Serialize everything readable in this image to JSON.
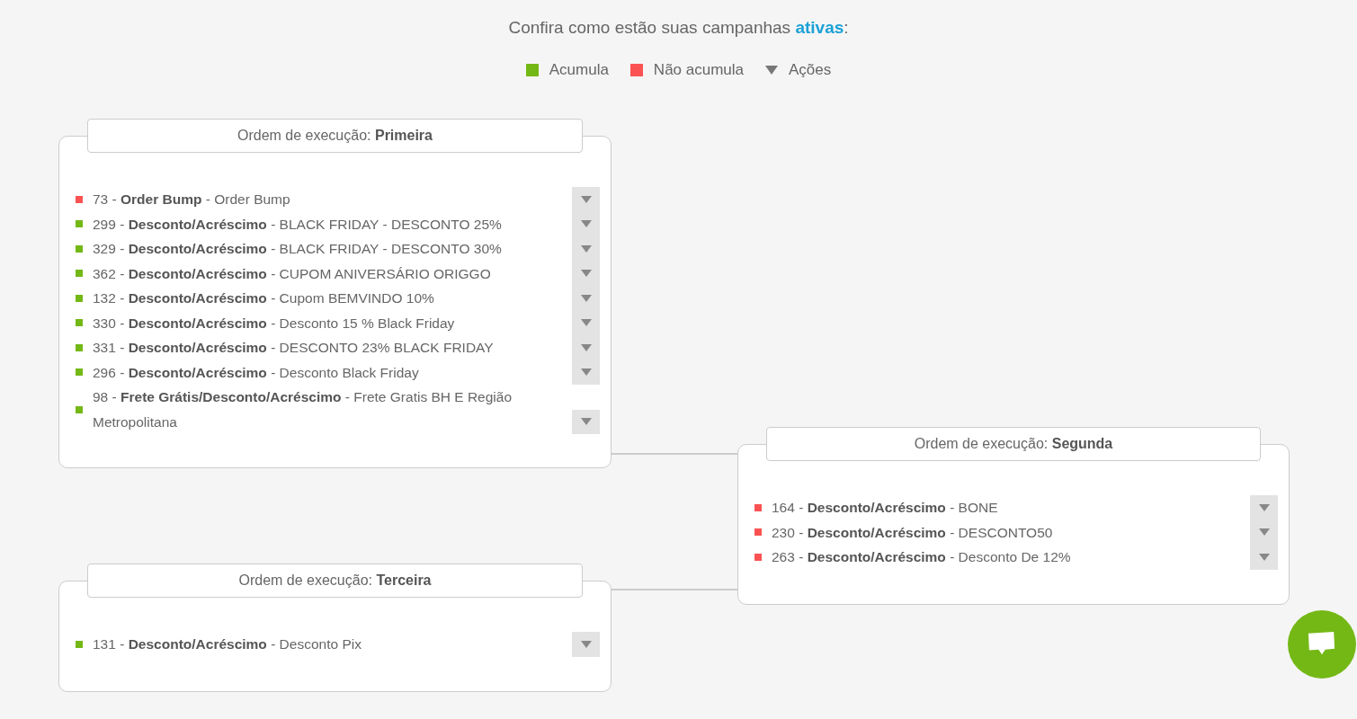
{
  "heading": "Confira como estão suas campanhas **ativas**:",
  "legend": [
    {
      "kind": "accumulates",
      "label": "Acumula"
    },
    {
      "kind": "not-accumulates",
      "label": "Não acumula"
    },
    {
      "kind": "actions",
      "label": "Ações"
    }
  ],
  "groups": [
    {
      "title": "Ordem de execução: **Primeira**",
      "campaigns": [
        {
          "accumulates": false,
          "text": "73 - **Order Bump** - Order Bump"
        },
        {
          "accumulates": true,
          "text": "299 - **Desconto/Acréscimo** - BLACK FRIDAY - DESCONTO 25%"
        },
        {
          "accumulates": true,
          "text": "329 - **Desconto/Acréscimo** - BLACK FRIDAY - DESCONTO 30%"
        },
        {
          "accumulates": true,
          "text": "362 - **Desconto/Acréscimo** - CUPOM ANIVERSÁRIO ORIGGO"
        },
        {
          "accumulates": true,
          "text": "132 - **Desconto/Acréscimo** - Cupom BEMVINDO 10%"
        },
        {
          "accumulates": true,
          "text": "330 - **Desconto/Acréscimo** - Desconto 15 % Black Friday"
        },
        {
          "accumulates": true,
          "text": "331 - **Desconto/Acréscimo** - DESCONTO 23% BLACK FRIDAY"
        },
        {
          "accumulates": true,
          "text": "296 - **Desconto/Acréscimo** - Desconto Black Friday"
        },
        {
          "accumulates": true,
          "text": "98 - **Frete Grátis/Desconto/Acréscimo** - Frete Gratis BH E Região Metropolitana"
        }
      ]
    },
    {
      "title": "Ordem de execução: **Segunda**",
      "campaigns": [
        {
          "accumulates": false,
          "text": "164 - **Desconto/Acréscimo** - BONE"
        },
        {
          "accumulates": false,
          "text": "230 - **Desconto/Acréscimo** - DESCONTO50"
        },
        {
          "accumulates": false,
          "text": "263 - **Desconto/Acréscimo** - Desconto De 12%"
        }
      ]
    },
    {
      "title": "Ordem de execução: **Terceira**",
      "campaigns": [
        {
          "accumulates": true,
          "text": "131 - **Desconto/Acréscimo** - Desconto Pix"
        }
      ]
    }
  ]
}
